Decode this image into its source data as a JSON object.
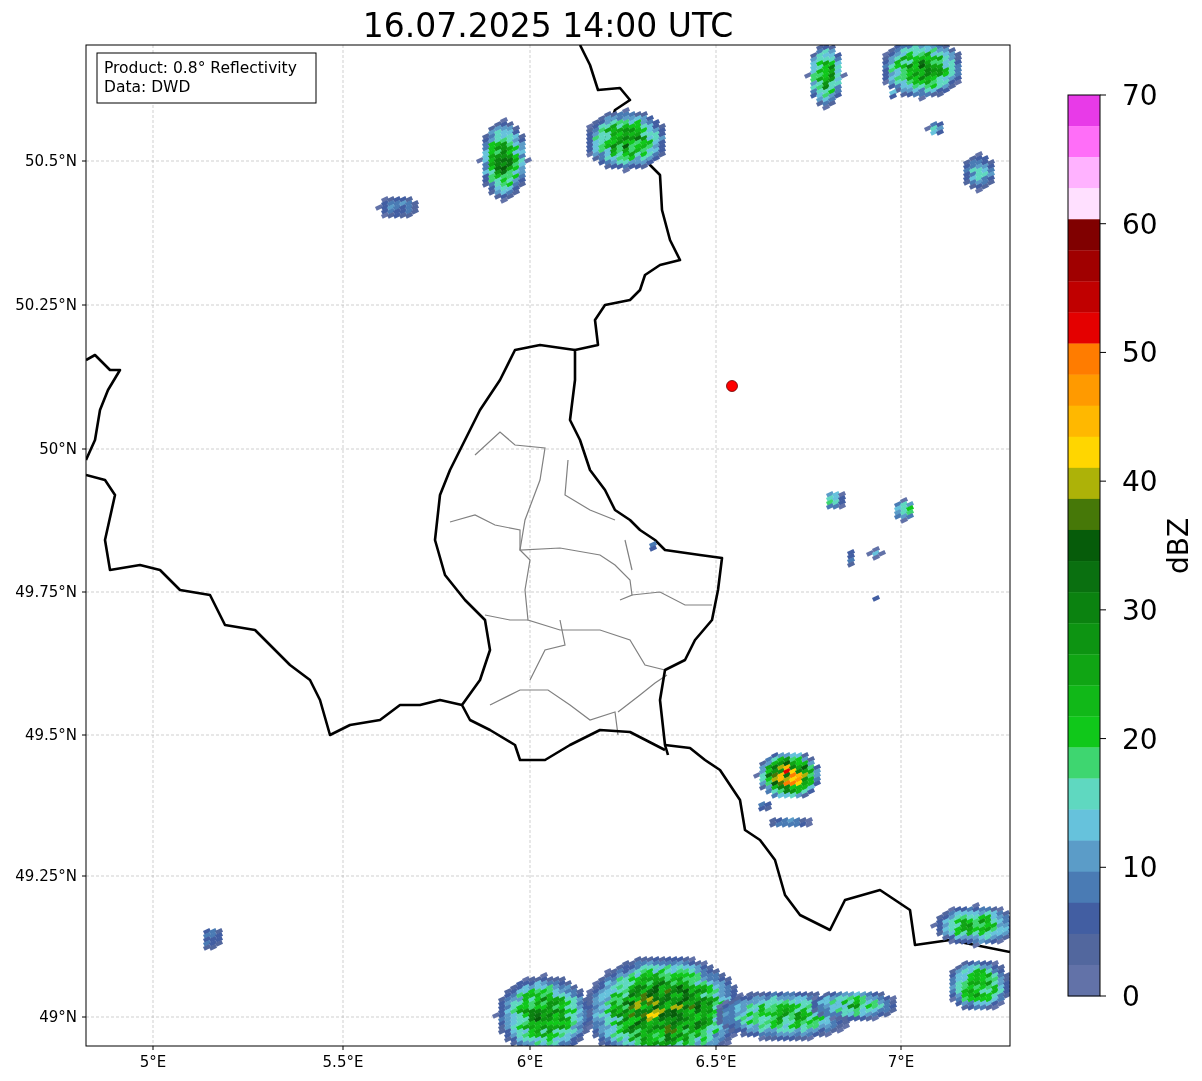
{
  "title": "16.07.2025 14:00 UTC",
  "legend": [
    "Product: 0.8° Reflectivity",
    "Data: DWD"
  ],
  "x_ticks": [
    "5°E",
    "5.5°E",
    "6°E",
    "6.5°E",
    "7°E"
  ],
  "y_ticks": [
    "50.5°N",
    "50.25°N",
    "50°N",
    "49.75°N",
    "49.5°N",
    "49.25°N",
    "49°N"
  ],
  "colorbar": {
    "label": "dBZ",
    "ticks": [
      "70",
      "60",
      "50",
      "40",
      "30",
      "20",
      "10",
      "0"
    ],
    "segments": [
      {
        "color": "#e83ae8"
      },
      {
        "color": "#ff6ef8"
      },
      {
        "color": "#ffb2ff"
      },
      {
        "color": "#ffe0ff"
      },
      {
        "color": "#800000"
      },
      {
        "color": "#a00000"
      },
      {
        "color": "#c00000"
      },
      {
        "color": "#e40000"
      },
      {
        "color": "#ff7c00"
      },
      {
        "color": "#ff9a00"
      },
      {
        "color": "#ffb800"
      },
      {
        "color": "#ffd600"
      },
      {
        "color": "#adb208"
      },
      {
        "color": "#467808"
      },
      {
        "color": "#065c0a"
      },
      {
        "color": "#0a7010"
      },
      {
        "color": "#0b8210"
      },
      {
        "color": "#0d9412"
      },
      {
        "color": "#10a514"
      },
      {
        "color": "#11b818"
      },
      {
        "color": "#10c81a"
      },
      {
        "color": "#3ed670"
      },
      {
        "color": "#5fd8c0"
      },
      {
        "color": "#66c2dc"
      },
      {
        "color": "#5b9cc8"
      },
      {
        "color": "#4a7bb4"
      },
      {
        "color": "#425ea2"
      },
      {
        "color": "#52679e"
      },
      {
        "color": "#6272a8"
      }
    ]
  }
}
